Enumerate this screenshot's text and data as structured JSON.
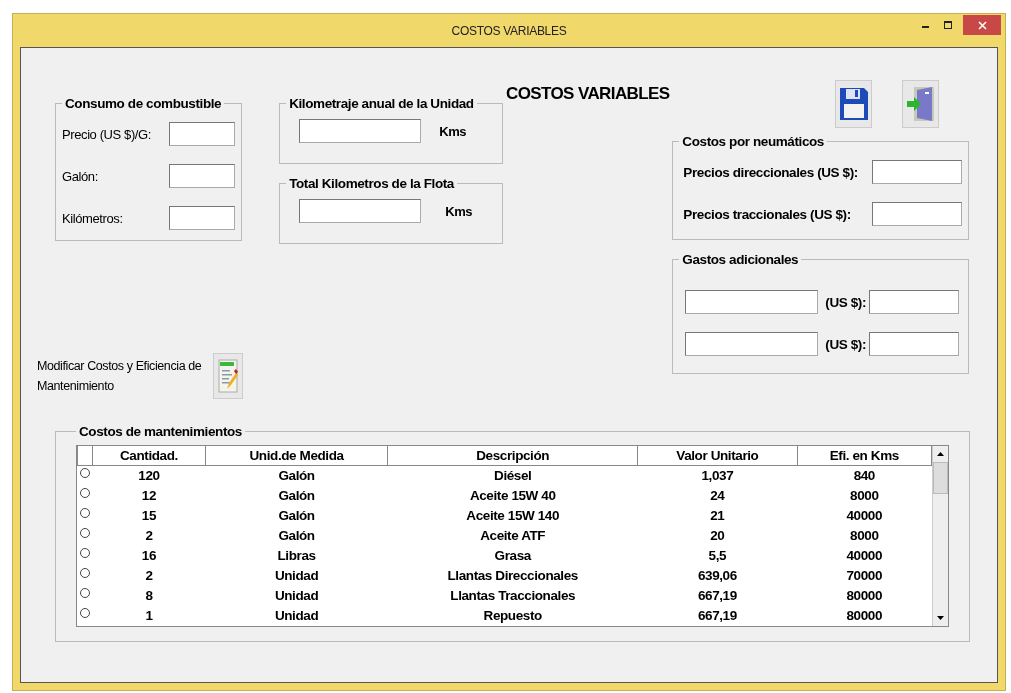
{
  "window": {
    "title": "COSTOS VARIABLES"
  },
  "heading": "COSTOS VARIABLES",
  "fuel": {
    "title": "Consumo de combustible",
    "fields": [
      {
        "label": "Precio (US $)/G:"
      },
      {
        "label": "Galón:"
      },
      {
        "label": "Kilómetros:"
      }
    ]
  },
  "annual_km": {
    "title": "Kilometraje anual de la Unidad",
    "unit": "Kms"
  },
  "fleet_km": {
    "title": "Total Kilometros de la Flota",
    "unit": "Kms"
  },
  "tires": {
    "title": "Costos por neumáticos",
    "fields": [
      {
        "label": "Precios direccionales (US $):"
      },
      {
        "label": "Precios traccionales (US $):"
      }
    ]
  },
  "extra": {
    "title": "Gastos adicionales",
    "rows": [
      {
        "label": "(US $):"
      },
      {
        "label": "(US $):"
      }
    ]
  },
  "modify_link": "Modificar Costos y Eficiencia de Mantenimiento",
  "maintenance": {
    "title": "Costos de mantenimientos",
    "columns": [
      "Cantidad.",
      "Unid.de Medida",
      "Descripción",
      "Valor Unitario",
      "Efi. en Kms"
    ],
    "rows": [
      {
        "selected": false,
        "cells": [
          "120",
          "Galón",
          "Diésel",
          "1,037",
          "840"
        ]
      },
      {
        "selected": false,
        "cells": [
          "12",
          "Galón",
          "Aceite 15W 40",
          "24",
          "8000"
        ]
      },
      {
        "selected": false,
        "cells": [
          "15",
          "Galón",
          "Aceite 15W 140",
          "21",
          "40000"
        ]
      },
      {
        "selected": false,
        "cells": [
          "2",
          "Galón",
          "Aceite ATF",
          "20",
          "8000"
        ]
      },
      {
        "selected": false,
        "cells": [
          "16",
          "Libras",
          "Grasa",
          "5,5",
          "40000"
        ]
      },
      {
        "selected": false,
        "cells": [
          "2",
          "Unidad",
          "Llantas Direccionales",
          "639,06",
          "70000"
        ]
      },
      {
        "selected": false,
        "cells": [
          "8",
          "Unidad",
          "Llantas Traccionales",
          "667,19",
          "80000"
        ]
      },
      {
        "selected": false,
        "cells": [
          "1",
          "Unidad",
          "Repuesto",
          "667,19",
          "80000"
        ]
      }
    ]
  }
}
